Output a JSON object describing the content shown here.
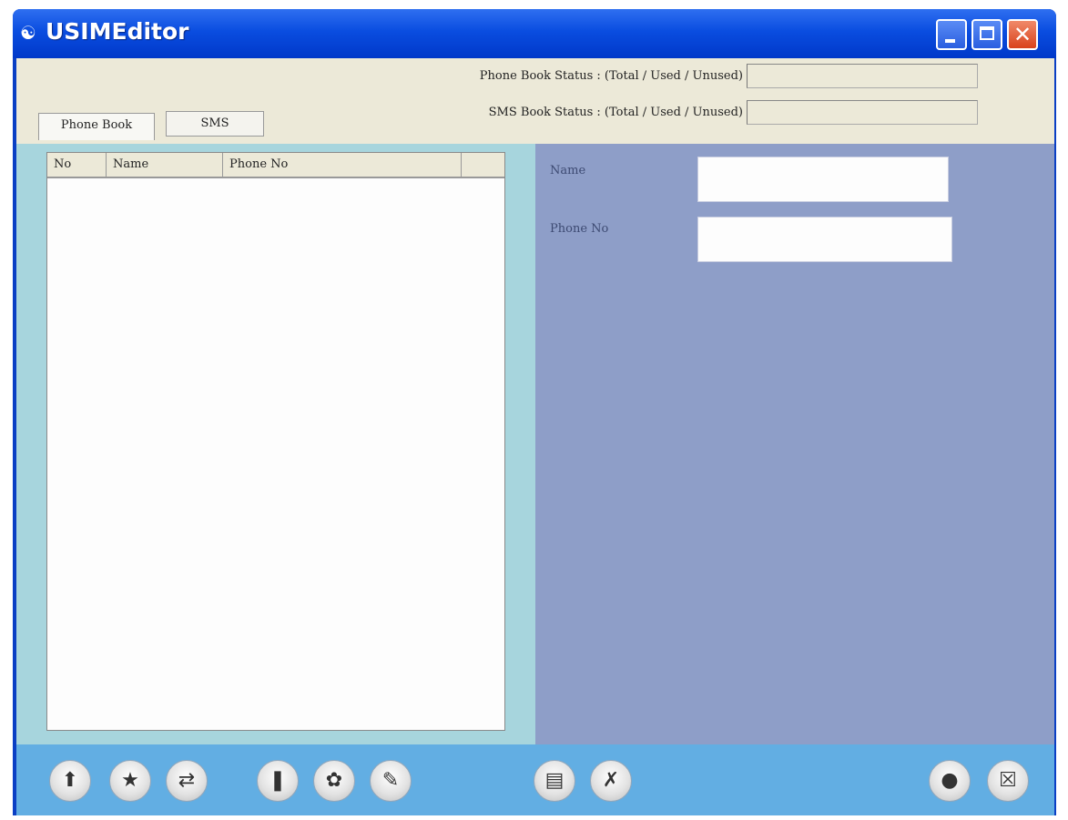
{
  "window": {
    "title": "USIMEditor"
  },
  "status": {
    "phone_book_label": "Phone Book Status : (Total / Used / Unused)",
    "sms_book_label": "SMS Book Status : (Total / Used / Unused)",
    "phone_book_value": "",
    "sms_book_value": ""
  },
  "tabs": [
    {
      "label": "Phone Book",
      "active": true
    },
    {
      "label": "SMS",
      "active": false
    }
  ],
  "list": {
    "columns": [
      "No",
      "Name",
      "Phone No",
      ""
    ]
  },
  "form": {
    "name_label": "Name",
    "phone_label": "Phone No",
    "name_value": "",
    "phone_value": ""
  },
  "toolbar": {
    "icons": [
      "upload-icon",
      "download-icon",
      "transfer-icon",
      "info-icon",
      "delete-icon",
      "edit-icon",
      "save-icon",
      "tools-icon",
      "globe-icon",
      "exit-icon"
    ]
  },
  "colors": {
    "titlebar": "#0a4de0",
    "status_area": "#ece9d8",
    "left_pane": "#a7d5dd",
    "right_pane": "#8e9ec8",
    "toolbar": "#62aee3"
  }
}
